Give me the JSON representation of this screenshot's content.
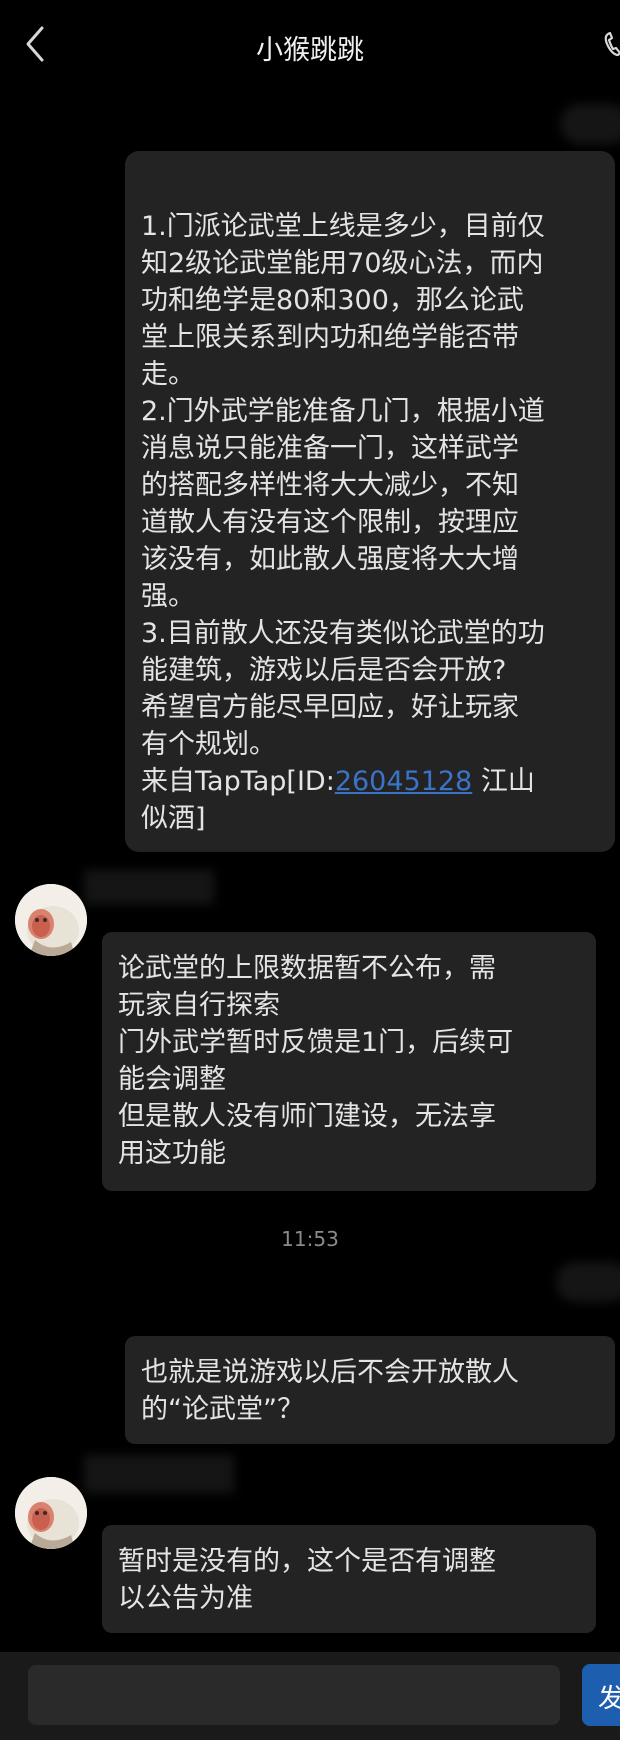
{
  "header": {
    "title": "小猴跳跳"
  },
  "messages": [
    {
      "lines": [
        "1.门派论武堂上线是多少，目前仅",
        "知2级论武堂能用70级心法，而内",
        "功和绝学是80和300，那么论武",
        "堂上限关系到内功和绝学能否带",
        "走。",
        "2.门外武学能准备几门，根据小道",
        "消息说只能准备一门，这样武学",
        "的搭配多样性将大大减少，不知",
        "道散人有没有这个限制，按理应",
        "该没有，如此散人强度将大大增",
        "强。",
        "3.目前散人还没有类似论武堂的功",
        "能建筑，游戏以后是否会开放?",
        "希望官方能尽早回应，好让玩家",
        "有个规划。"
      ],
      "source_prefix": "来自TapTap[ID:",
      "source_id": "26045128",
      "source_suffix": " 江山",
      "source_last": "似酒]"
    },
    {
      "lines": [
        "论武堂的上限数据暂不公布，需",
        "玩家自行探索",
        "门外武学暂时反馈是1门，后续可",
        "能会调整",
        "但是散人没有师门建设，无法享",
        "用这功能"
      ]
    },
    {
      "lines": [
        "也就是说游戏以后不会开放散人",
        "的“论武堂”？"
      ]
    },
    {
      "lines": [
        "暂时是没有的，这个是否有调整",
        "以公告为准"
      ]
    }
  ],
  "timestamp": "11:53",
  "composer": {
    "send_label": "发"
  },
  "colors": {
    "background": "#000000",
    "bubble": "#232323",
    "link": "#3b73c8",
    "send_button": "#1d5fae"
  },
  "icons": [
    "back-arrow-icon",
    "phone-icon",
    "avatar-monkey-icon"
  ]
}
